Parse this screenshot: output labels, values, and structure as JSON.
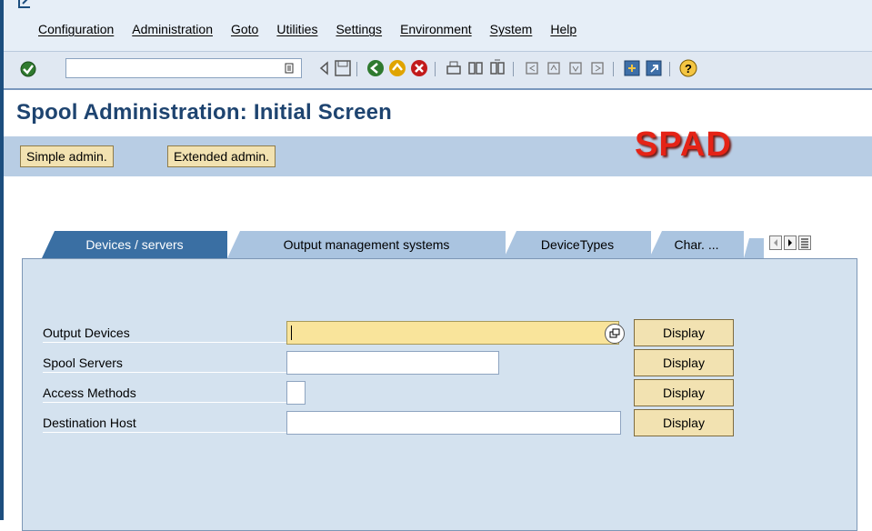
{
  "menubar": {
    "items": [
      "Configuration",
      "Administration",
      "Goto",
      "Utilities",
      "Settings",
      "Environment",
      "System",
      "Help"
    ]
  },
  "toolbar": {
    "command_field_value": "",
    "icons": [
      "enter-icon",
      "history-icon",
      "back-nav-icon",
      "save-icon",
      "back-icon",
      "exit-icon",
      "cancel-icon",
      "print-icon",
      "find-icon",
      "find-next-icon",
      "first-page-icon",
      "previous-page-icon",
      "next-page-icon",
      "last-page-icon",
      "create-session-icon",
      "shortcut-icon",
      "help-icon"
    ]
  },
  "screen": {
    "title": "Spool Administration: Initial Screen",
    "overlay_label": "SPAD"
  },
  "app_toolbar": {
    "simple_admin": "Simple admin.",
    "extended_admin": "Extended admin."
  },
  "tabs": [
    {
      "label": "Devices / servers",
      "active": true
    },
    {
      "label": "Output management systems",
      "active": false
    },
    {
      "label": "DeviceTypes",
      "active": false
    },
    {
      "label": "Char. ...",
      "active": false
    }
  ],
  "form": {
    "rows": [
      {
        "label": "Output Devices",
        "value": "",
        "button": "Display"
      },
      {
        "label": "Spool Servers",
        "value": "",
        "button": "Display"
      },
      {
        "label": "Access Methods",
        "value": "",
        "button": "Display"
      },
      {
        "label": "Destination Host",
        "value": "",
        "button": "Display"
      }
    ]
  },
  "colors": {
    "title": "#1e4470",
    "accent_red": "#e52316",
    "active_tab": "#3a6fa3",
    "focused_field": "#f9e49b"
  }
}
